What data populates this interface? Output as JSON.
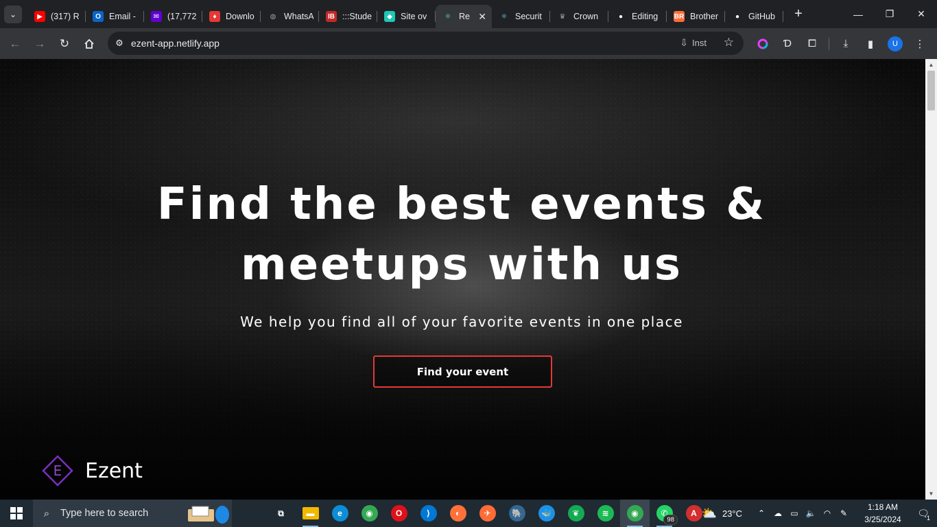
{
  "browser": {
    "tabs": [
      {
        "title": "(317) R",
        "icon": "youtube-icon",
        "color": "#ff0000",
        "glyph": "▶"
      },
      {
        "title": "Email -",
        "icon": "outlook-icon",
        "color": "#0a64c9",
        "glyph": "O"
      },
      {
        "title": "(17,772",
        "icon": "yahoo-mail-icon",
        "color": "#6001d2",
        "glyph": "✉"
      },
      {
        "title": "Downlo",
        "icon": "download-site-icon",
        "color": "#e53935",
        "glyph": "♦"
      },
      {
        "title": "WhatsA",
        "icon": "globe-icon",
        "color": "#9aa0a6",
        "glyph": "◍"
      },
      {
        "title": ":::Stude",
        "icon": "iba-icon",
        "color": "#c62828",
        "glyph": "IB"
      },
      {
        "title": "Site ov",
        "icon": "netlify-icon",
        "color": "#20c6b7",
        "glyph": "◆"
      },
      {
        "title": "Re",
        "icon": "react-icon",
        "color": "#61dafb",
        "glyph": "⚛",
        "active": true
      },
      {
        "title": "Securit",
        "icon": "react-icon",
        "color": "#61dafb",
        "glyph": "⚛"
      },
      {
        "title": "Crown",
        "icon": "crown-icon",
        "color": "#9aa0a6",
        "glyph": "♛"
      },
      {
        "title": "Editing",
        "icon": "github-icon",
        "color": "#ffffff",
        "glyph": "●"
      },
      {
        "title": "Brother",
        "icon": "brother-icon",
        "color": "#ff6b35",
        "glyph": "BR"
      },
      {
        "title": "GitHub",
        "icon": "github-icon",
        "color": "#ffffff",
        "glyph": "●"
      }
    ],
    "url": "ezent-app.netlify.app",
    "install_label": "Inst",
    "profile_initial": "U"
  },
  "hero": {
    "title_line1": "Find the best events &",
    "title_line2": "meetups with us",
    "subtitle": "We help you find all of your favorite events in one place",
    "cta_label": "Find your event",
    "accent_color": "#e53935"
  },
  "brand": {
    "logo_letter": "E",
    "name": "Ezent",
    "logo_color": "#7b2fbe"
  },
  "taskbar": {
    "search_placeholder": "Type here to search",
    "apps": [
      {
        "name": "task-view-icon",
        "color": "transparent",
        "glyph": "⧉"
      },
      {
        "name": "file-explorer-icon",
        "color": "#f2b900",
        "glyph": "▬"
      },
      {
        "name": "edge-icon",
        "color": "#0c8dd6",
        "glyph": "e"
      },
      {
        "name": "chrome-icon",
        "color": "#34a853",
        "glyph": "◉"
      },
      {
        "name": "opera-icon",
        "color": "#e0101a",
        "glyph": "O"
      },
      {
        "name": "vscode-icon",
        "color": "#0078d4",
        "glyph": "⟩"
      },
      {
        "name": "firefox-icon",
        "color": "#ff7139",
        "glyph": "◐"
      },
      {
        "name": "postman-icon",
        "color": "#ff6c37",
        "glyph": "✈"
      },
      {
        "name": "postgresql-icon",
        "color": "#336791",
        "glyph": "🐘"
      },
      {
        "name": "docker-icon",
        "color": "#1d91e6",
        "glyph": "🐳"
      },
      {
        "name": "mongodb-icon",
        "color": "#13aa52",
        "glyph": "❦"
      },
      {
        "name": "spotify-icon",
        "color": "#1db954",
        "glyph": "≋"
      },
      {
        "name": "chrome-profile-icon",
        "color": "#34a853",
        "glyph": "◉",
        "active": true
      },
      {
        "name": "whatsapp-icon",
        "color": "#25d366",
        "glyph": "✆",
        "badge": "98"
      },
      {
        "name": "acrobat-icon",
        "color": "#d32f2f",
        "glyph": "A"
      }
    ],
    "weather": "23°C",
    "time": "1:18 AM",
    "date": "3/25/2024",
    "notification_count": "1"
  }
}
